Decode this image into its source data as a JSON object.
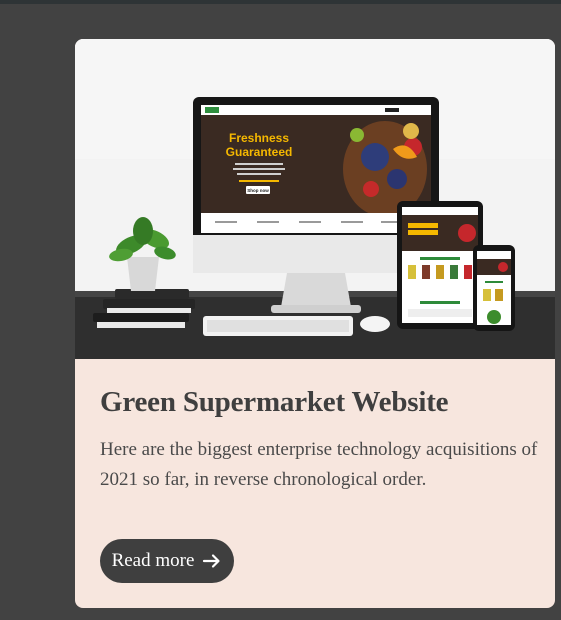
{
  "card": {
    "image_alt": "Green Supermarket Website mockup on desktop, tablet and phone",
    "screen_headline_1": "Freshness",
    "screen_headline_2": "Guaranteed",
    "screen_button": "Shop now",
    "title": "Green Supermarket Website",
    "description": "Here are the biggest enterprise technology acquisitions of 2021 so far, in reverse chronological order.",
    "button_label": "Read more",
    "button_icon": "arrow-right-icon"
  },
  "colors": {
    "page_background": "#424242",
    "card_background": "#f7e6de",
    "button_background": "#3f3f3f",
    "title_color": "#3f3f3f",
    "accent_yellow": "#f5b800"
  }
}
